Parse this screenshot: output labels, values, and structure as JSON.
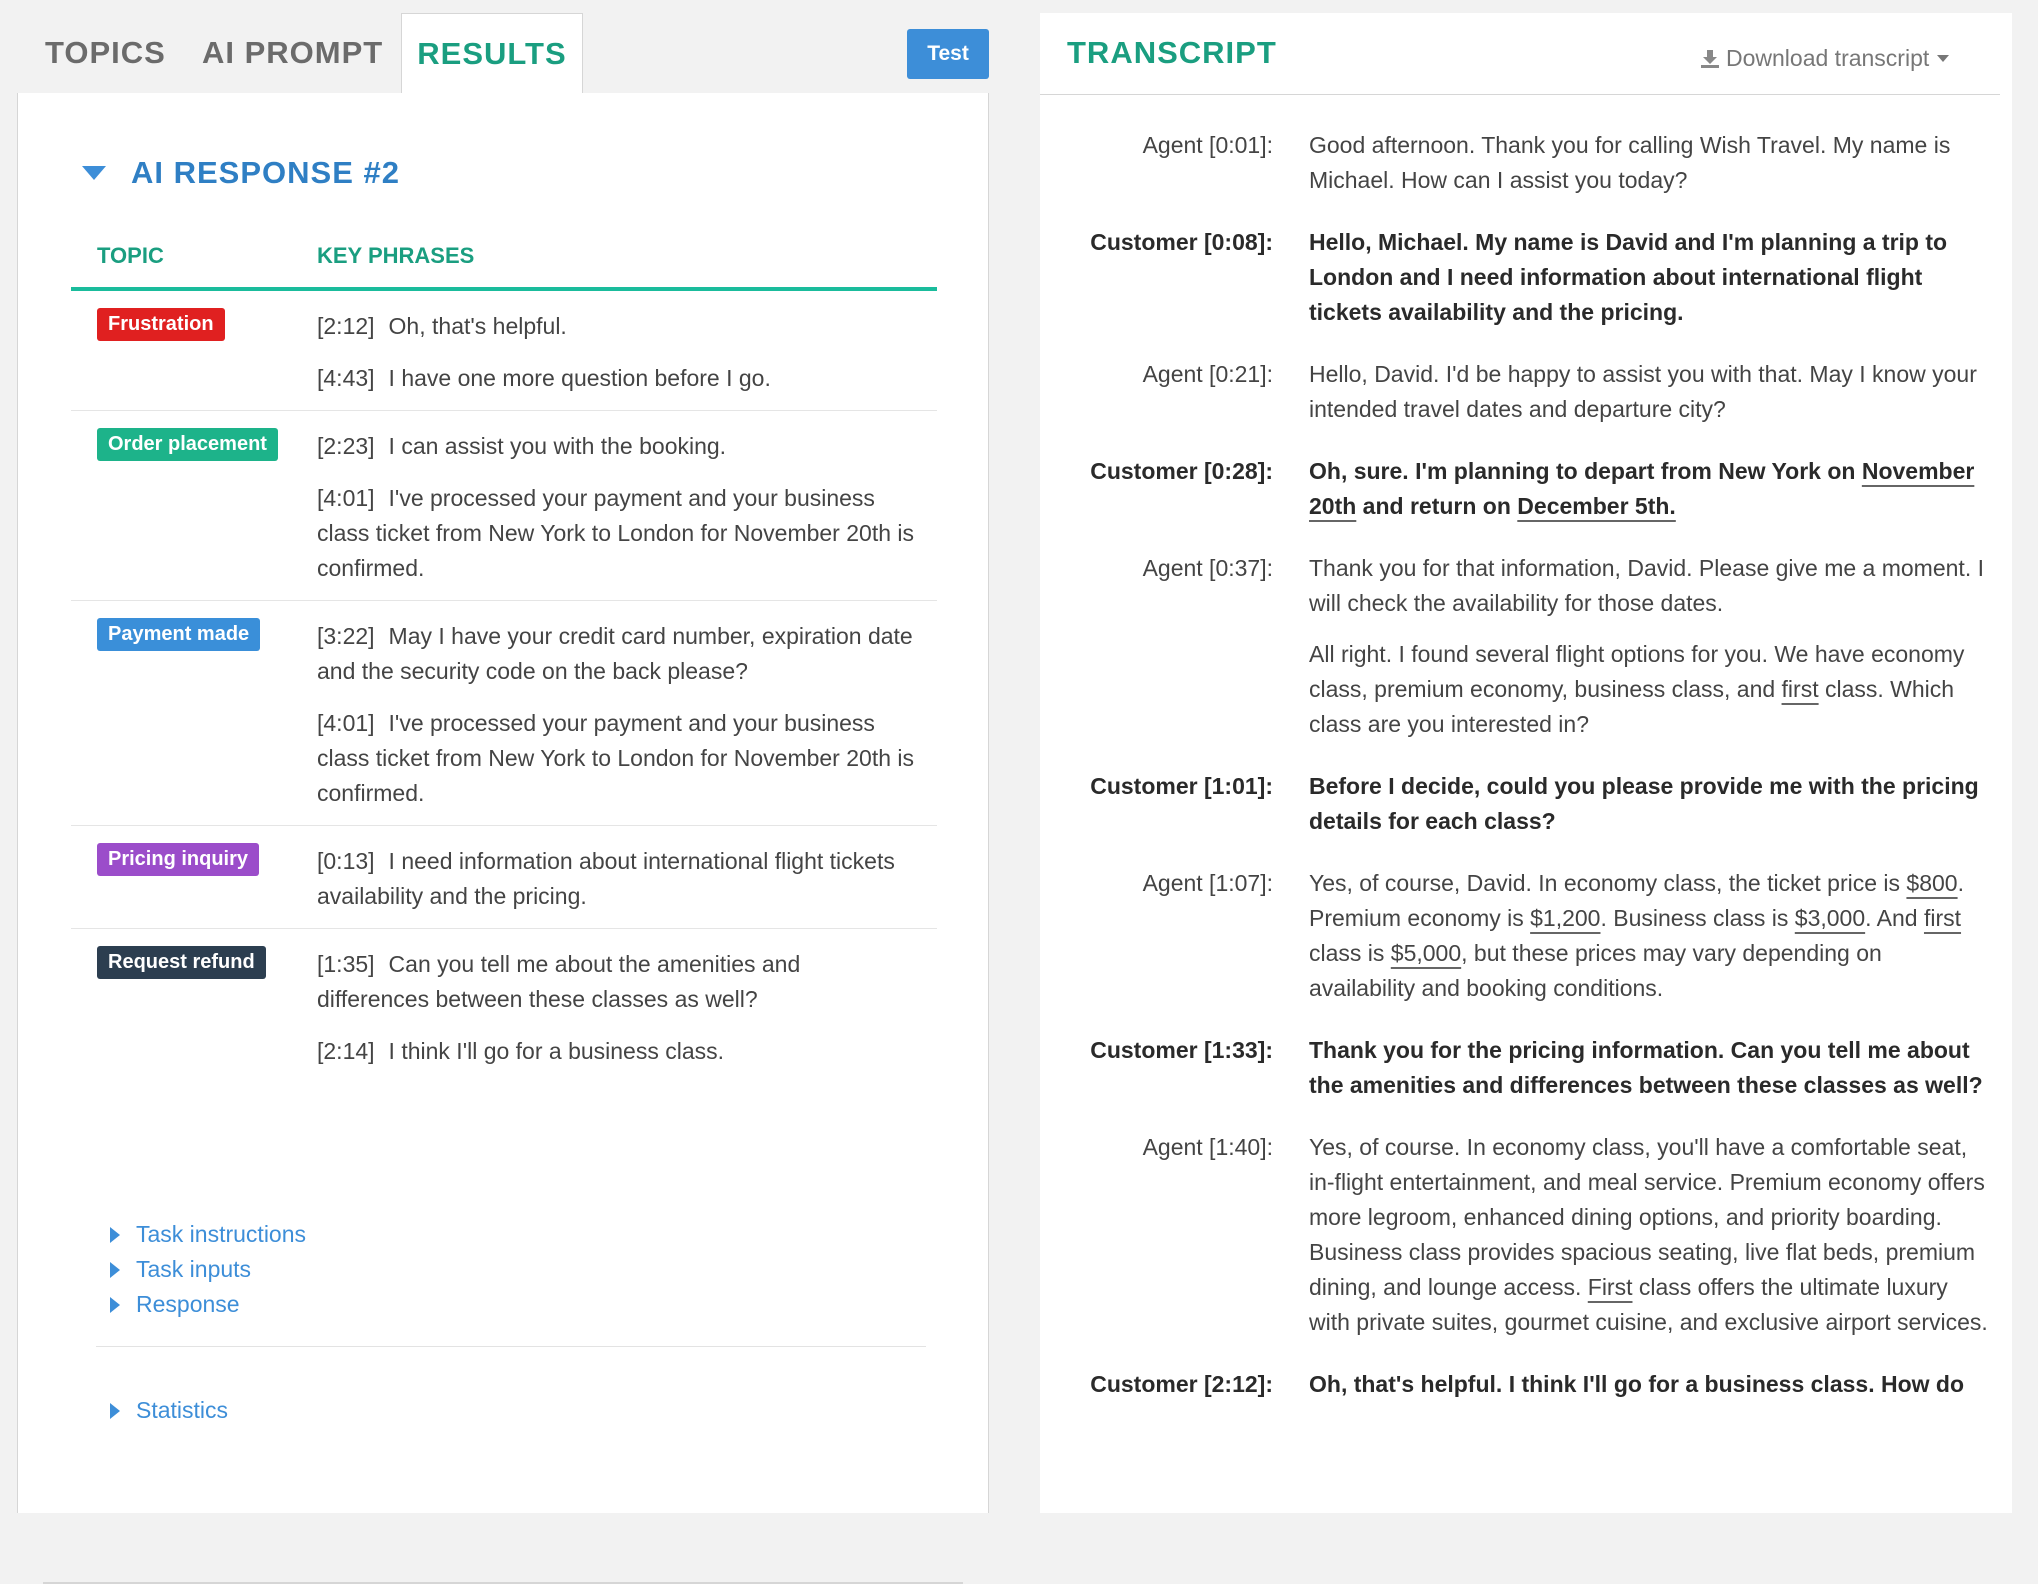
{
  "tabs": [
    {
      "label": "TOPICS"
    },
    {
      "label": "AI PROMPT"
    },
    {
      "label": "RESULTS"
    }
  ],
  "test_button": "Test",
  "response_title": "AI RESPONSE #2",
  "table_headers": {
    "topic": "TOPIC",
    "phrases": "KEY PHRASES"
  },
  "topics": [
    {
      "label": "Frustration",
      "color": "#e02020",
      "phrases": [
        {
          "ts": "[2:12]",
          "text": "Oh, that's helpful."
        },
        {
          "ts": "[4:43]",
          "text": "I have one more question before I go."
        }
      ]
    },
    {
      "label": "Order placement",
      "color": "#1db38a",
      "phrases": [
        {
          "ts": "[2:23]",
          "text": "I can assist you with the booking."
        },
        {
          "ts": "[4:01]",
          "text": "I've processed your payment and your business class ticket from New York to London for November 20th is confirmed."
        }
      ]
    },
    {
      "label": "Payment made",
      "color": "#3a8fd9",
      "phrases": [
        {
          "ts": "[3:22]",
          "text": "May I have your credit card number, expiration date and the security code on the back please?"
        },
        {
          "ts": "[4:01]",
          "text": "I've processed your payment and your business class ticket from New York to London for November 20th is confirmed."
        }
      ]
    },
    {
      "label": "Pricing inquiry",
      "color": "#9b4dca",
      "phrases": [
        {
          "ts": "[0:13]",
          "text": "I need information about international flight tickets availability and the pricing."
        }
      ]
    },
    {
      "label": "Request refund",
      "color": "#2c3e50",
      "phrases": [
        {
          "ts": "[1:35]",
          "text": "Can you tell me about the amenities and differences between these classes as well?"
        },
        {
          "ts": "[2:14]",
          "text": "I think I'll go for a business class."
        }
      ]
    }
  ],
  "links": [
    "Task instructions",
    "Task inputs",
    "Response"
  ],
  "statistics_link": "Statistics",
  "transcript": {
    "title": "TRANSCRIPT",
    "download_label": "Download transcript",
    "entries": [
      {
        "speaker": "Agent [0:01]:",
        "role": "agent",
        "paragraphs": [
          [
            {
              "t": "Good afternoon. Thank you for calling Wish Travel. My name is Michael. How can I assist you today?"
            }
          ]
        ]
      },
      {
        "speaker": "Customer [0:08]:",
        "role": "customer",
        "paragraphs": [
          [
            {
              "t": "Hello, Michael. My name is David and I'm planning a trip to London and I need information about international flight tickets availability and the pricing."
            }
          ]
        ]
      },
      {
        "speaker": "Agent [0:21]:",
        "role": "agent",
        "paragraphs": [
          [
            {
              "t": "Hello, David. I'd be happy to assist you with that. May I know your intended travel dates and departure city?"
            }
          ]
        ]
      },
      {
        "speaker": "Customer [0:28]:",
        "role": "customer",
        "paragraphs": [
          [
            {
              "t": "Oh, sure. I'm planning to depart from New York on "
            },
            {
              "t": "November 20th",
              "u": true
            },
            {
              "t": " and return on "
            },
            {
              "t": "December 5th.",
              "u": true
            }
          ]
        ]
      },
      {
        "speaker": "Agent [0:37]:",
        "role": "agent",
        "paragraphs": [
          [
            {
              "t": "Thank you for that information, David. Please give me a moment. I will check the availability for those dates."
            }
          ],
          [
            {
              "t": "All right. I found several flight options for you. We have economy class, premium economy, business class, and "
            },
            {
              "t": "first",
              "u": true
            },
            {
              "t": " class. Which class are you interested in?"
            }
          ]
        ]
      },
      {
        "speaker": "Customer [1:01]:",
        "role": "customer",
        "paragraphs": [
          [
            {
              "t": "Before I decide, could you please provide me with the pricing details for each class?"
            }
          ]
        ]
      },
      {
        "speaker": "Agent [1:07]:",
        "role": "agent",
        "paragraphs": [
          [
            {
              "t": "Yes, of course, David. In economy class, the ticket price is "
            },
            {
              "t": "$800",
              "u": true
            },
            {
              "t": ". Premium economy is "
            },
            {
              "t": "$1,200",
              "u": true
            },
            {
              "t": ". Business class is "
            },
            {
              "t": "$3,000",
              "u": true
            },
            {
              "t": ". And "
            },
            {
              "t": "first",
              "u": true
            },
            {
              "t": " class is "
            },
            {
              "t": "$5,000",
              "u": true
            },
            {
              "t": ", but these prices may vary depending on availability and booking conditions."
            }
          ]
        ]
      },
      {
        "speaker": "Customer [1:33]:",
        "role": "customer",
        "paragraphs": [
          [
            {
              "t": "Thank you for the pricing information. Can you tell me about the amenities and differences between these classes as well?"
            }
          ]
        ]
      },
      {
        "speaker": "Agent [1:40]:",
        "role": "agent",
        "paragraphs": [
          [
            {
              "t": "Yes, of course. In economy class, you'll have a comfortable seat, in-flight entertainment, and meal service. Premium economy offers more legroom, enhanced dining options, and priority boarding. Business class provides spacious seating, live flat beds, premium dining, and lounge access. "
            },
            {
              "t": "First",
              "u": true
            },
            {
              "t": " class offers the ultimate luxury with private suites, gourmet cuisine, and exclusive airport services."
            }
          ]
        ]
      },
      {
        "speaker": "Customer [2:12]:",
        "role": "customer",
        "paragraphs": [
          [
            {
              "t": "Oh, that's helpful. I think I'll go for a business class. How do"
            }
          ]
        ]
      }
    ]
  }
}
